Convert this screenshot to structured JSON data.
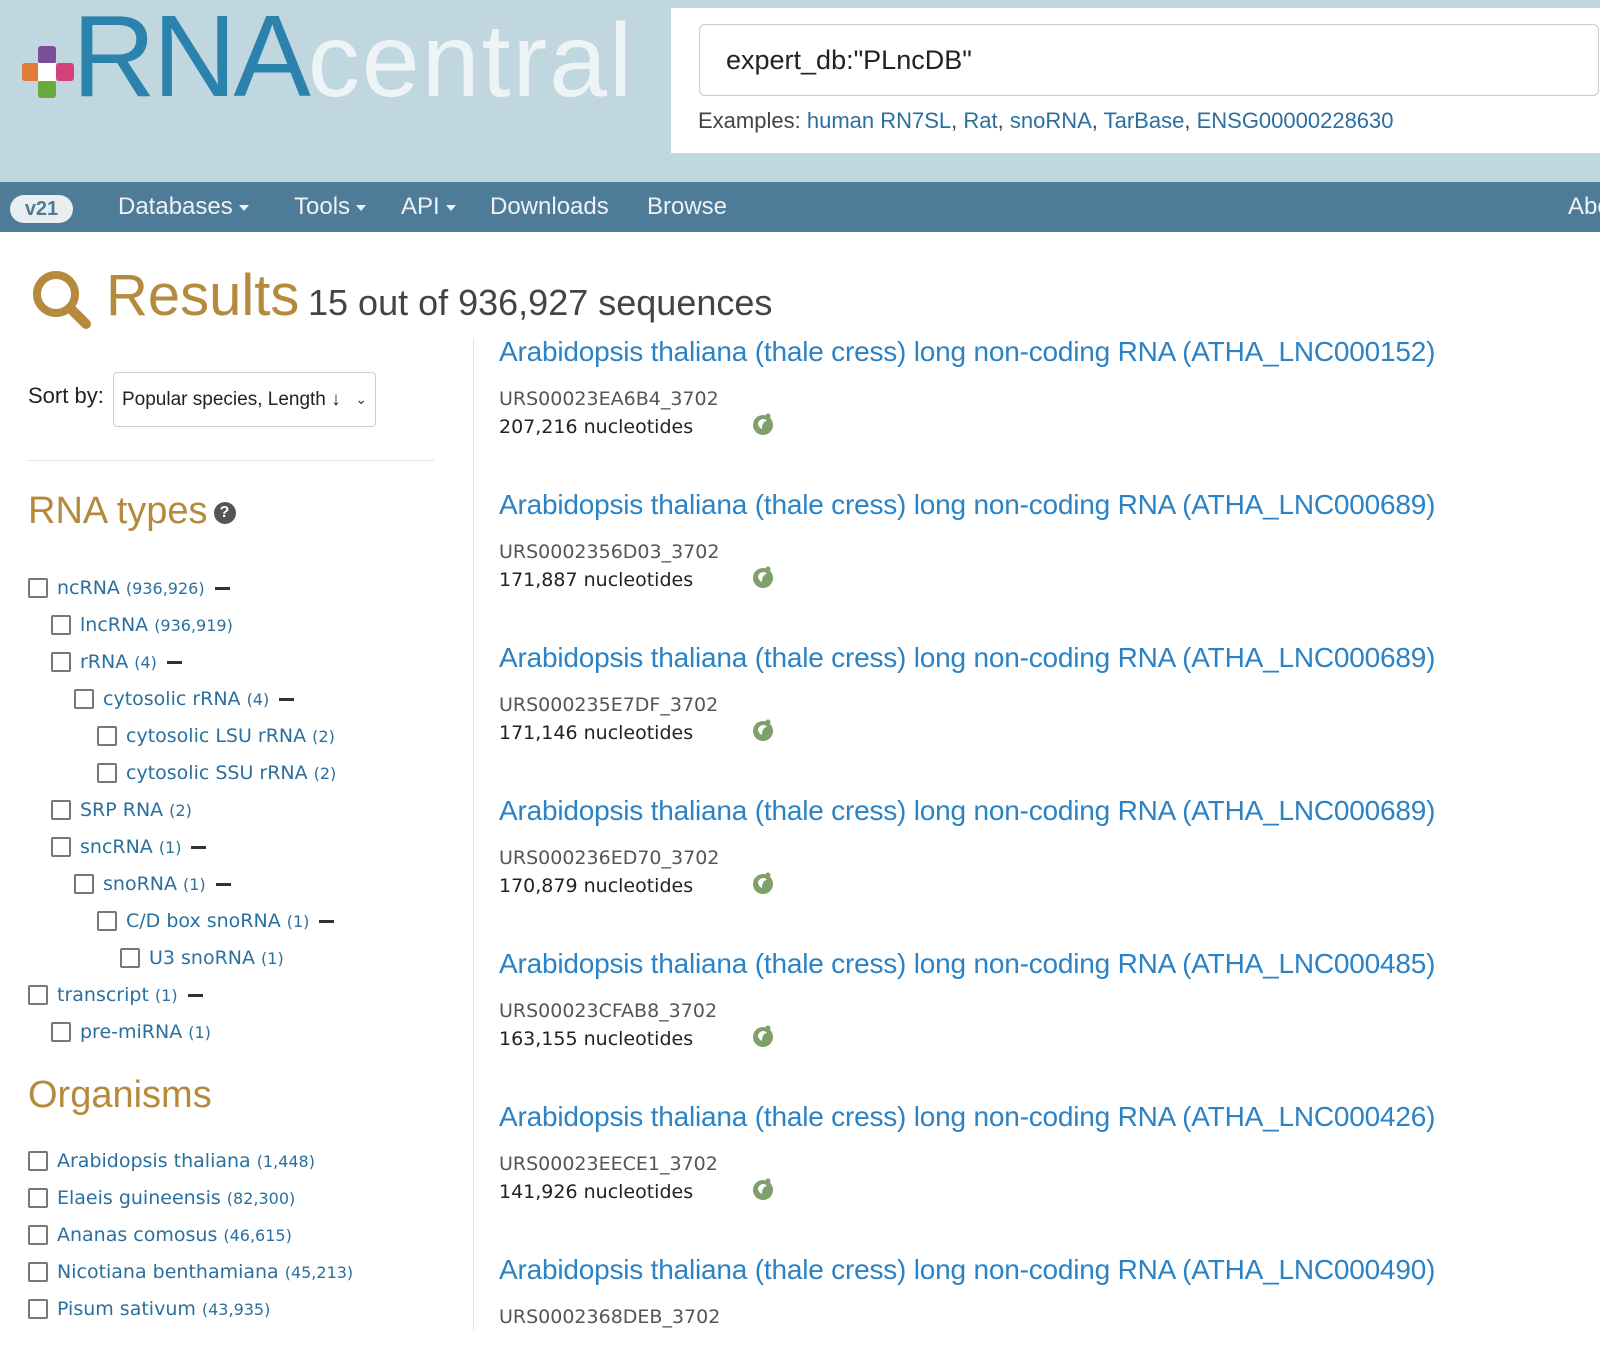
{
  "header": {
    "logo_rna": "RNA",
    "logo_central": "central",
    "search_value": "expert_db:\"PLncDB\"",
    "examples_label": "Examples:",
    "examples": [
      "human RN7SL",
      "Rat",
      "snoRNA",
      "TarBase",
      "ENSG00000228630"
    ]
  },
  "nav": {
    "version": "v21",
    "items": [
      {
        "label": "Databases",
        "dropdown": true
      },
      {
        "label": "Tools",
        "dropdown": true
      },
      {
        "label": "API",
        "dropdown": true
      },
      {
        "label": "Downloads",
        "dropdown": false
      },
      {
        "label": "Browse",
        "dropdown": false
      },
      {
        "label": "Abo",
        "dropdown": false
      }
    ]
  },
  "results_header": {
    "title": "Results",
    "count_text": "15 out of 936,927 sequences"
  },
  "sort": {
    "label": "Sort by:",
    "selected": "Popular species, Length ↓"
  },
  "rna_types": {
    "title": "RNA types",
    "items": [
      {
        "label": "ncRNA",
        "count": "(936,926)",
        "level": 0,
        "expanded": true
      },
      {
        "label": "lncRNA",
        "count": "(936,919)",
        "level": 1,
        "expanded": false
      },
      {
        "label": "rRNA",
        "count": "(4)",
        "level": 1,
        "expanded": true
      },
      {
        "label": "cytosolic rRNA",
        "count": "(4)",
        "level": 2,
        "expanded": true
      },
      {
        "label": "cytosolic LSU rRNA",
        "count": "(2)",
        "level": 3,
        "expanded": false
      },
      {
        "label": "cytosolic SSU rRNA",
        "count": "(2)",
        "level": 3,
        "expanded": false
      },
      {
        "label": "SRP RNA",
        "count": "(2)",
        "level": 1,
        "expanded": false
      },
      {
        "label": "sncRNA",
        "count": "(1)",
        "level": 1,
        "expanded": true
      },
      {
        "label": "snoRNA",
        "count": "(1)",
        "level": 2,
        "expanded": true
      },
      {
        "label": "C/D box snoRNA",
        "count": "(1)",
        "level": 3,
        "expanded": true
      },
      {
        "label": "U3 snoRNA",
        "count": "(1)",
        "level": 4,
        "expanded": false
      },
      {
        "label": "transcript",
        "count": "(1)",
        "level": 0,
        "expanded": true
      },
      {
        "label": "pre-miRNA",
        "count": "(1)",
        "level": 1,
        "expanded": false
      }
    ]
  },
  "organisms": {
    "title": "Organisms",
    "items": [
      {
        "label": "Arabidopsis thaliana",
        "count": "(1,448)"
      },
      {
        "label": "Elaeis guineensis",
        "count": "(82,300)"
      },
      {
        "label": "Ananas comosus",
        "count": "(46,615)"
      },
      {
        "label": "Nicotiana benthamiana",
        "count": "(45,213)"
      },
      {
        "label": "Pisum sativum",
        "count": "(43,935)"
      }
    ]
  },
  "results": [
    {
      "title": "Arabidopsis thaliana (thale cress) long non-coding RNA (ATHA_LNC000152)",
      "id": "URS00023EA6B4_3702",
      "length": "207,216 nucleotides"
    },
    {
      "title": "Arabidopsis thaliana (thale cress) long non-coding RNA (ATHA_LNC000689)",
      "id": "URS0002356D03_3702",
      "length": "171,887 nucleotides"
    },
    {
      "title": "Arabidopsis thaliana (thale cress) long non-coding RNA (ATHA_LNC000689)",
      "id": "URS000235E7DF_3702",
      "length": "171,146 nucleotides"
    },
    {
      "title": "Arabidopsis thaliana (thale cress) long non-coding RNA (ATHA_LNC000689)",
      "id": "URS000236ED70_3702",
      "length": "170,879 nucleotides"
    },
    {
      "title": "Arabidopsis thaliana (thale cress) long non-coding RNA (ATHA_LNC000485)",
      "id": "URS00023CFAB8_3702",
      "length": "163,155 nucleotides"
    },
    {
      "title": "Arabidopsis thaliana (thale cress) long non-coding RNA (ATHA_LNC000426)",
      "id": "URS00023EECE1_3702",
      "length": "141,926 nucleotides"
    },
    {
      "title": "Arabidopsis thaliana (thale cress) long non-coding RNA (ATHA_LNC000490)",
      "id": "URS0002368DEB_3702",
      "length": ""
    }
  ]
}
